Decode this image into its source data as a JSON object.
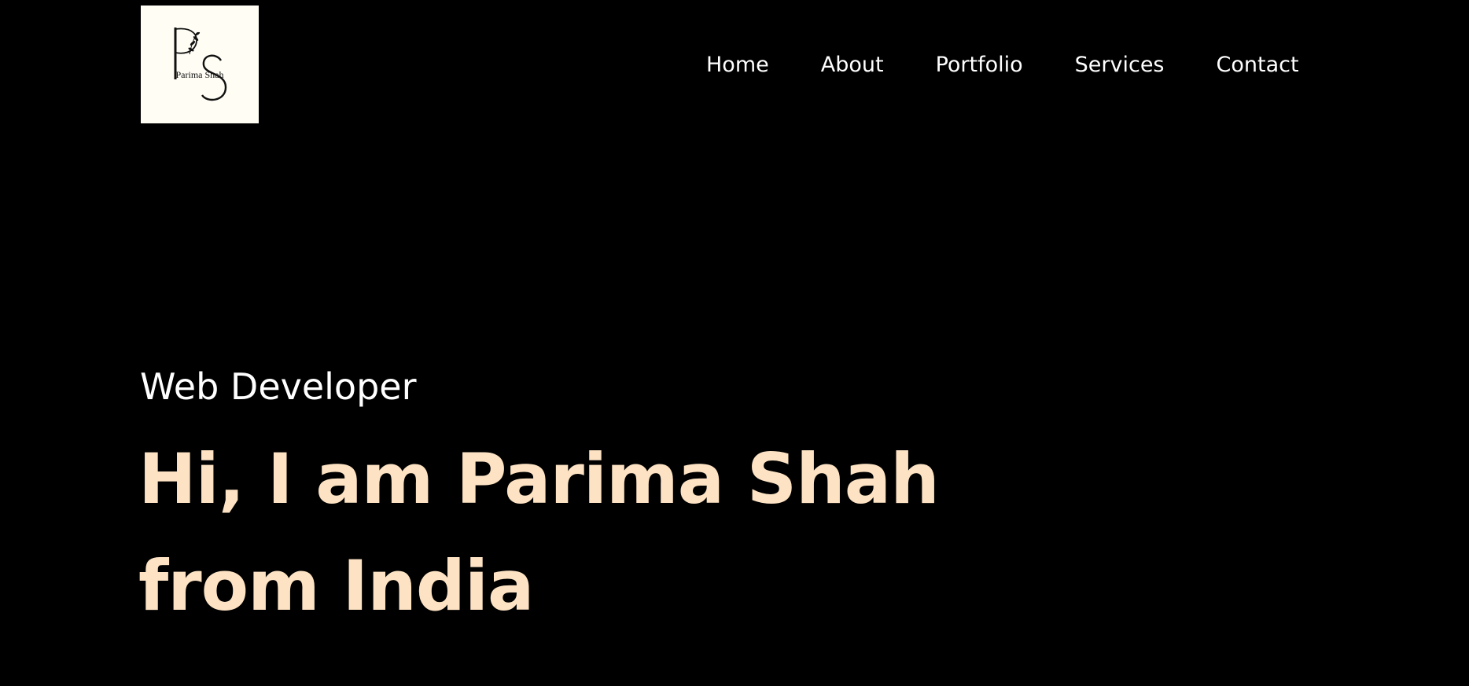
{
  "logo": {
    "monogram_primary": "P",
    "monogram_secondary": "S",
    "name": "Parima Shah",
    "background": "#fffdf4"
  },
  "nav": {
    "items": [
      {
        "label": "Home"
      },
      {
        "label": "About"
      },
      {
        "label": "Portfolio"
      },
      {
        "label": "Services"
      },
      {
        "label": "Contact"
      }
    ]
  },
  "hero": {
    "role": "Web Developer",
    "headline_line1": "Hi, I am Parima Shah",
    "headline_line2": "from India"
  },
  "colors": {
    "background": "#000000",
    "text": "#ffffff",
    "accent": "#fde3c4"
  }
}
